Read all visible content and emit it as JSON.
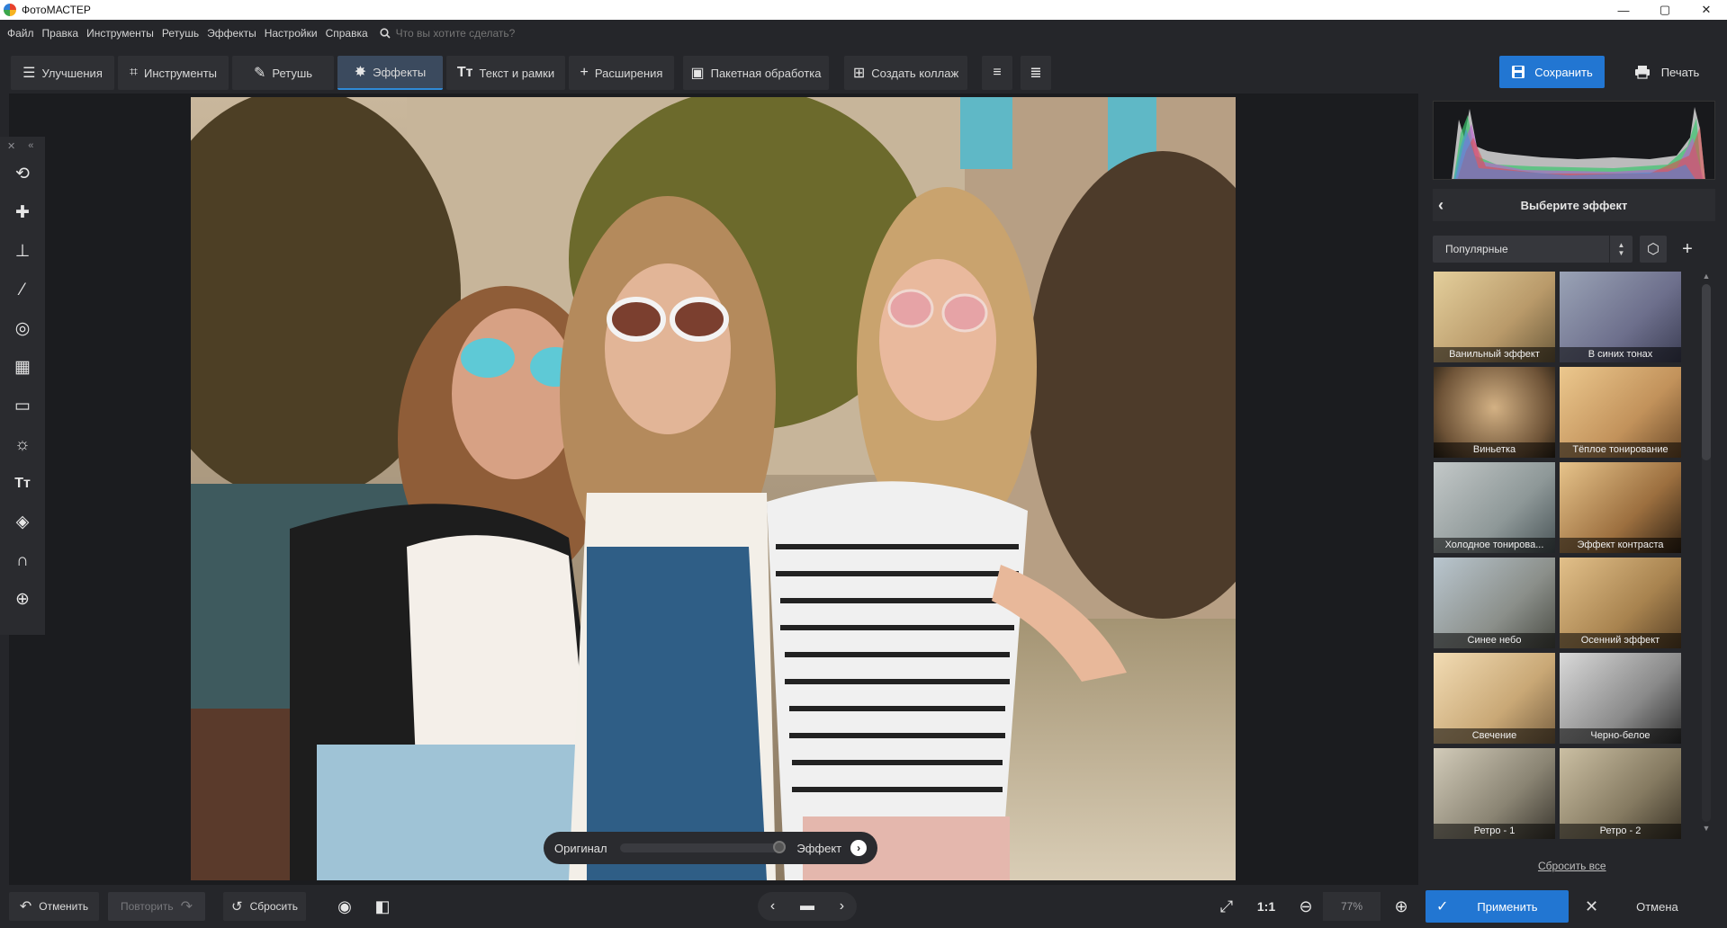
{
  "window": {
    "title": "ФотоМАСТЕР",
    "minimize": "—",
    "maximize": "▢",
    "close": "✕"
  },
  "menu": {
    "items": [
      "Файл",
      "Правка",
      "Инструменты",
      "Ретушь",
      "Эффекты",
      "Настройки",
      "Справка"
    ],
    "search_placeholder": "Что вы хотите сделать?"
  },
  "toolbar": {
    "tabs": [
      {
        "label": "Улучшения",
        "icon": "sliders-icon"
      },
      {
        "label": "Инструменты",
        "icon": "crop-icon"
      },
      {
        "label": "Ретушь",
        "icon": "brush-icon"
      },
      {
        "label": "Эффекты",
        "icon": "sparkle-icon"
      },
      {
        "label": "Текст и рамки",
        "icon": "text-icon"
      },
      {
        "label": "Расширения",
        "icon": "plus-icon"
      },
      {
        "label": "Пакетная обработка",
        "icon": "batch-icon"
      },
      {
        "label": "Создать коллаж",
        "icon": "collage-icon"
      }
    ],
    "active_tab": "Эффекты",
    "save_label": "Сохранить",
    "print_label": "Печать"
  },
  "compare": {
    "original_label": "Оригинал",
    "effect_label": "Эффект"
  },
  "effects_panel": {
    "title": "Выберите эффект",
    "category": "Популярные",
    "effects": [
      "Ванильный эффект",
      "В синих тонах",
      "Виньетка",
      "Тёплое тонирование",
      "Холодное тонирова...",
      "Эффект контраста",
      "Синее небо",
      "Осенний эффект",
      "Свечение",
      "Черно-белое",
      "Ретро - 1",
      "Ретро - 2"
    ],
    "reset_all": "Сбросить все"
  },
  "bottombar": {
    "undo_label": "Отменить",
    "redo_label": "Повторить",
    "reset_label": "Сбросить",
    "ratio_label": "1:1",
    "zoom": "77%",
    "apply_label": "Применить",
    "cancel_label": "Отмена"
  },
  "colors": {
    "accent": "#2276d2",
    "panel": "#25262a",
    "background": "#1b1c1f"
  }
}
